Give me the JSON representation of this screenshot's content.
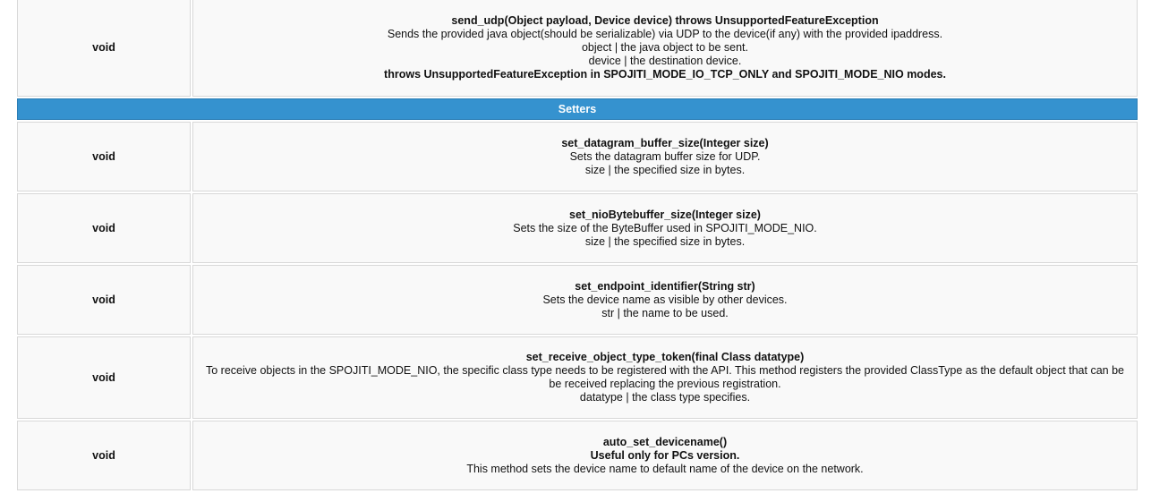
{
  "rows_top": [
    {
      "type": "void",
      "signature": "send_udp(Object payload, Device device) throws UnsupportedFeatureException",
      "lines": [
        "Sends the provided java object(should be serializable) via UDP to the device(if any) with the provided ipaddress.",
        "object | the java object to be sent.",
        "device | the destination device."
      ],
      "bold_note": "throws UnsupportedFeatureException in SPOJITI_MODE_IO_TCP_ONLY and SPOJITI_MODE_NIO modes."
    }
  ],
  "section": {
    "label": "Setters"
  },
  "rows": [
    {
      "type": "void",
      "signature": "set_datagram_buffer_size(Integer size)",
      "line1": "Sets the datagram buffer size for UDP.",
      "line2": "size | the specified size in bytes."
    },
    {
      "type": "void",
      "signature": "set_nioBytebuffer_size(Integer size)",
      "line1": "Sets the size of the ByteBuffer used in SPOJITI_MODE_NIO.",
      "line2": "size | the specified size in bytes."
    },
    {
      "type": "void",
      "signature": "set_endpoint_identifier(String str)",
      "line1": "Sets the device name as visible by other devices.",
      "line2": "str | the name to be used."
    },
    {
      "type": "void",
      "signature": "set_receive_object_type_token(final Class datatype)",
      "line1": "To receive objects in the SPOJITI_MODE_NIO, the specific class type needs to be registered with the API. This method registers the provided ClassType as the default object that can be be received replacing the previous registration.",
      "line2": "datatype | the class type specifies."
    },
    {
      "type": "void",
      "signature": "auto_set_devicename()",
      "bold_line": "Useful only for PCs version.",
      "line2": "This method sets the device name to default name of the device on the network."
    }
  ]
}
